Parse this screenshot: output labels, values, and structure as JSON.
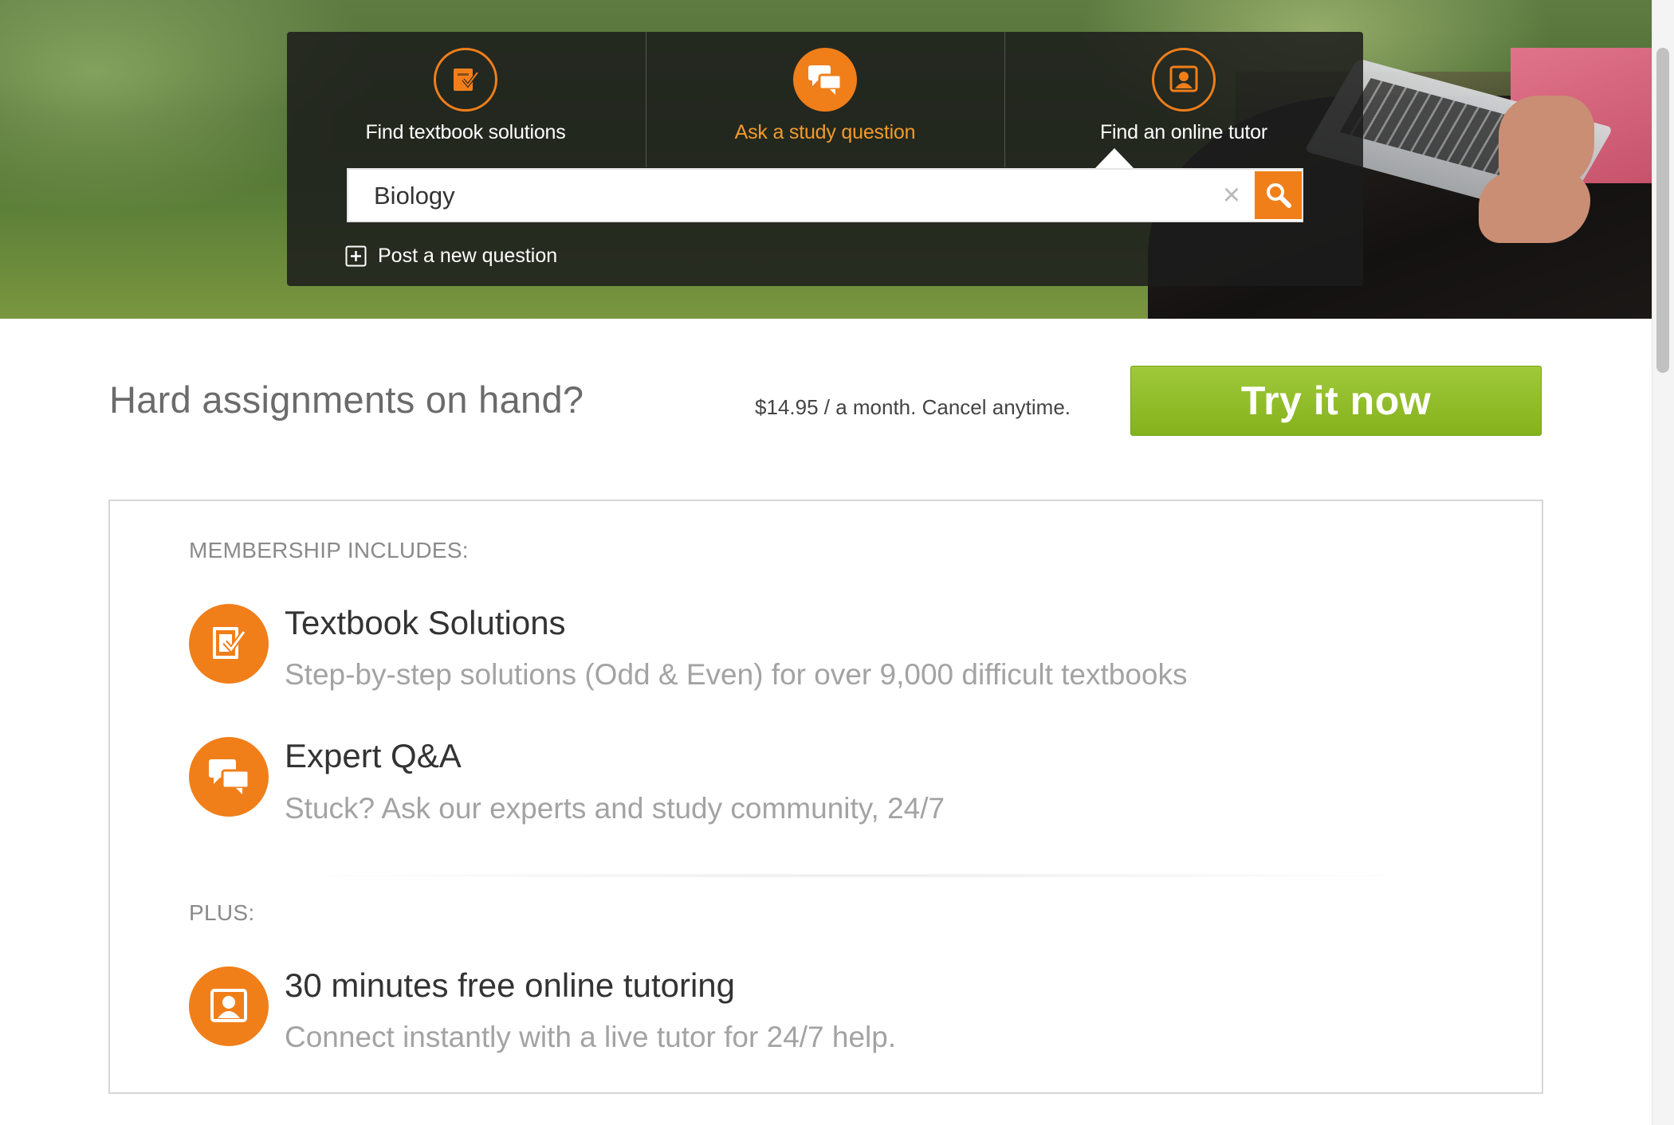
{
  "hero": {
    "tabs": [
      {
        "label": "Find textbook solutions",
        "icon": "textbook-icon",
        "active": false
      },
      {
        "label": "Ask a study question",
        "icon": "chat-icon",
        "active": true
      },
      {
        "label": "Find an online tutor",
        "icon": "tutor-icon",
        "active": false
      }
    ],
    "search": {
      "value": "Biology",
      "clear_icon": "close-icon",
      "search_icon": "search-icon"
    },
    "post_question": {
      "label": "Post a new question",
      "icon": "plus-box-icon"
    }
  },
  "promo": {
    "title": "Hard assignments on hand?",
    "price_text": "$14.95 / a month. Cancel anytime.",
    "cta_label": "Try it now"
  },
  "membership": {
    "includes_label": "MEMBERSHIP INCLUDES:",
    "features": [
      {
        "title": "Textbook Solutions",
        "desc": "Step-by-step solutions (Odd & Even) for over 9,000 difficult textbooks",
        "icon": "textbook-icon"
      },
      {
        "title": "Expert Q&A",
        "desc": "Stuck? Ask our experts and study community, 24/7",
        "icon": "chat-icon"
      }
    ],
    "plus_label": "PLUS:",
    "plus_features": [
      {
        "title": "30 minutes free online tutoring",
        "desc": "Connect instantly with a live tutor for 24/7 help.",
        "icon": "tutor-icon"
      }
    ]
  },
  "colors": {
    "accent": "#f07f1a",
    "cta_green": "#8bbb24",
    "panel": "#1c1c1c"
  }
}
